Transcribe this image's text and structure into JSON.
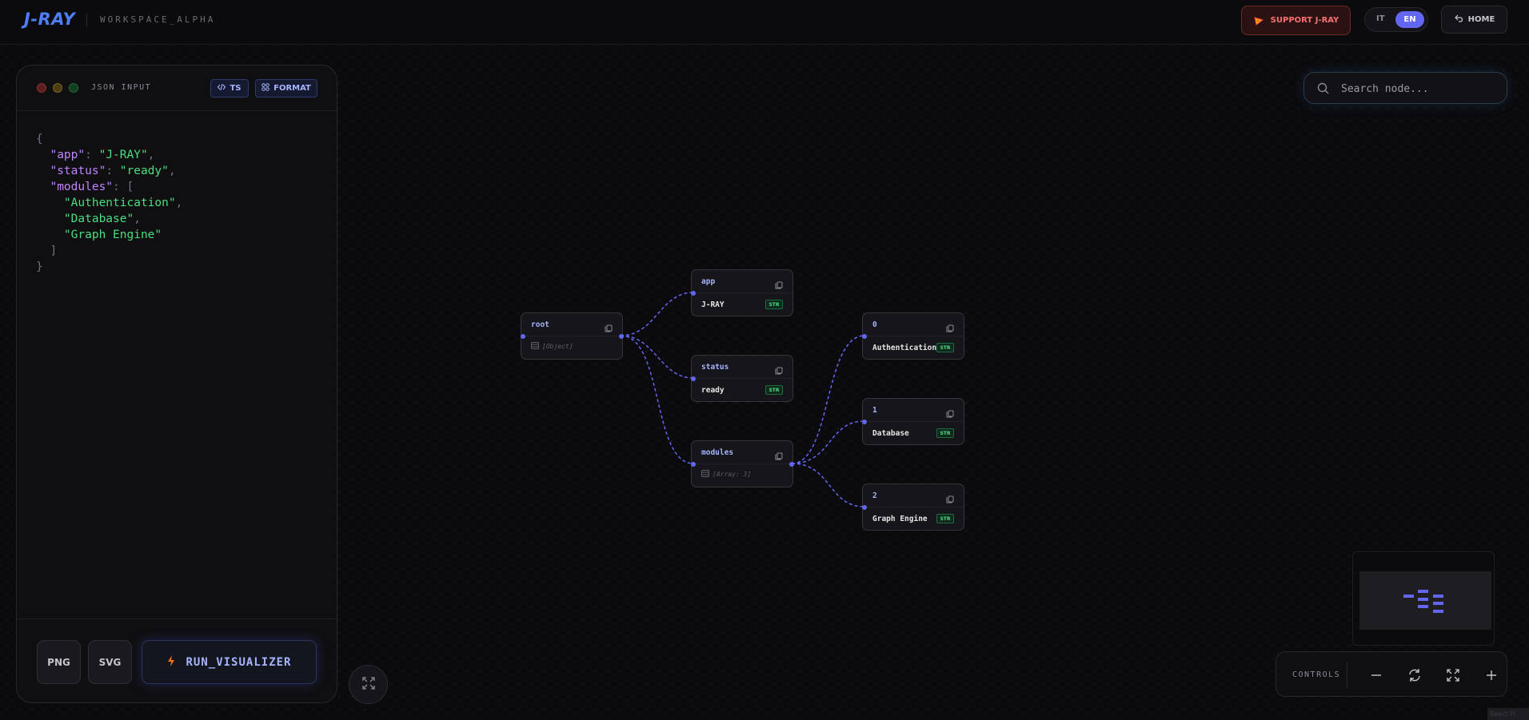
{
  "header": {
    "logo": "J-RAY",
    "workspace": "WORKSPACE_ALPHA",
    "support_label": "SUPPORT J-RAY",
    "lang_it": "IT",
    "lang_en": "EN",
    "home_label": "HOME"
  },
  "panel": {
    "title": "JSON INPUT",
    "ts_label": "TS",
    "format_label": "FORMAT",
    "json_lines": [
      "{",
      "  \"app\": \"J-RAY\",",
      "  \"status\": \"ready\",",
      "  \"modules\": [",
      "    \"Authentication\",",
      "    \"Database\",",
      "    \"Graph Engine\"",
      "  ]",
      "}"
    ],
    "png_label": "PNG",
    "svg_label": "SVG",
    "run_label": "RUN_VISUALIZER"
  },
  "search": {
    "placeholder": "Search node..."
  },
  "graph": {
    "nodes": {
      "root": {
        "key": "root",
        "value": "[Object]"
      },
      "app": {
        "key": "app",
        "value": "J-RAY",
        "type": "STR"
      },
      "status": {
        "key": "status",
        "value": "ready",
        "type": "STR"
      },
      "modules": {
        "key": "modules",
        "value": "[Array: 3]"
      },
      "item0": {
        "key": "0",
        "value": "Authentication",
        "type": "STR"
      },
      "item1": {
        "key": "1",
        "value": "Database",
        "type": "STR"
      },
      "item2": {
        "key": "2",
        "value": "Graph Engine",
        "type": "STR"
      }
    }
  },
  "controls": {
    "label": "CONTROLS"
  },
  "watermark": "React Fl",
  "colors": {
    "accent": "#6366f1",
    "brand": "#4f7df5",
    "string": "#4ade80",
    "key": "#c084fc",
    "danger": "#f87171"
  }
}
